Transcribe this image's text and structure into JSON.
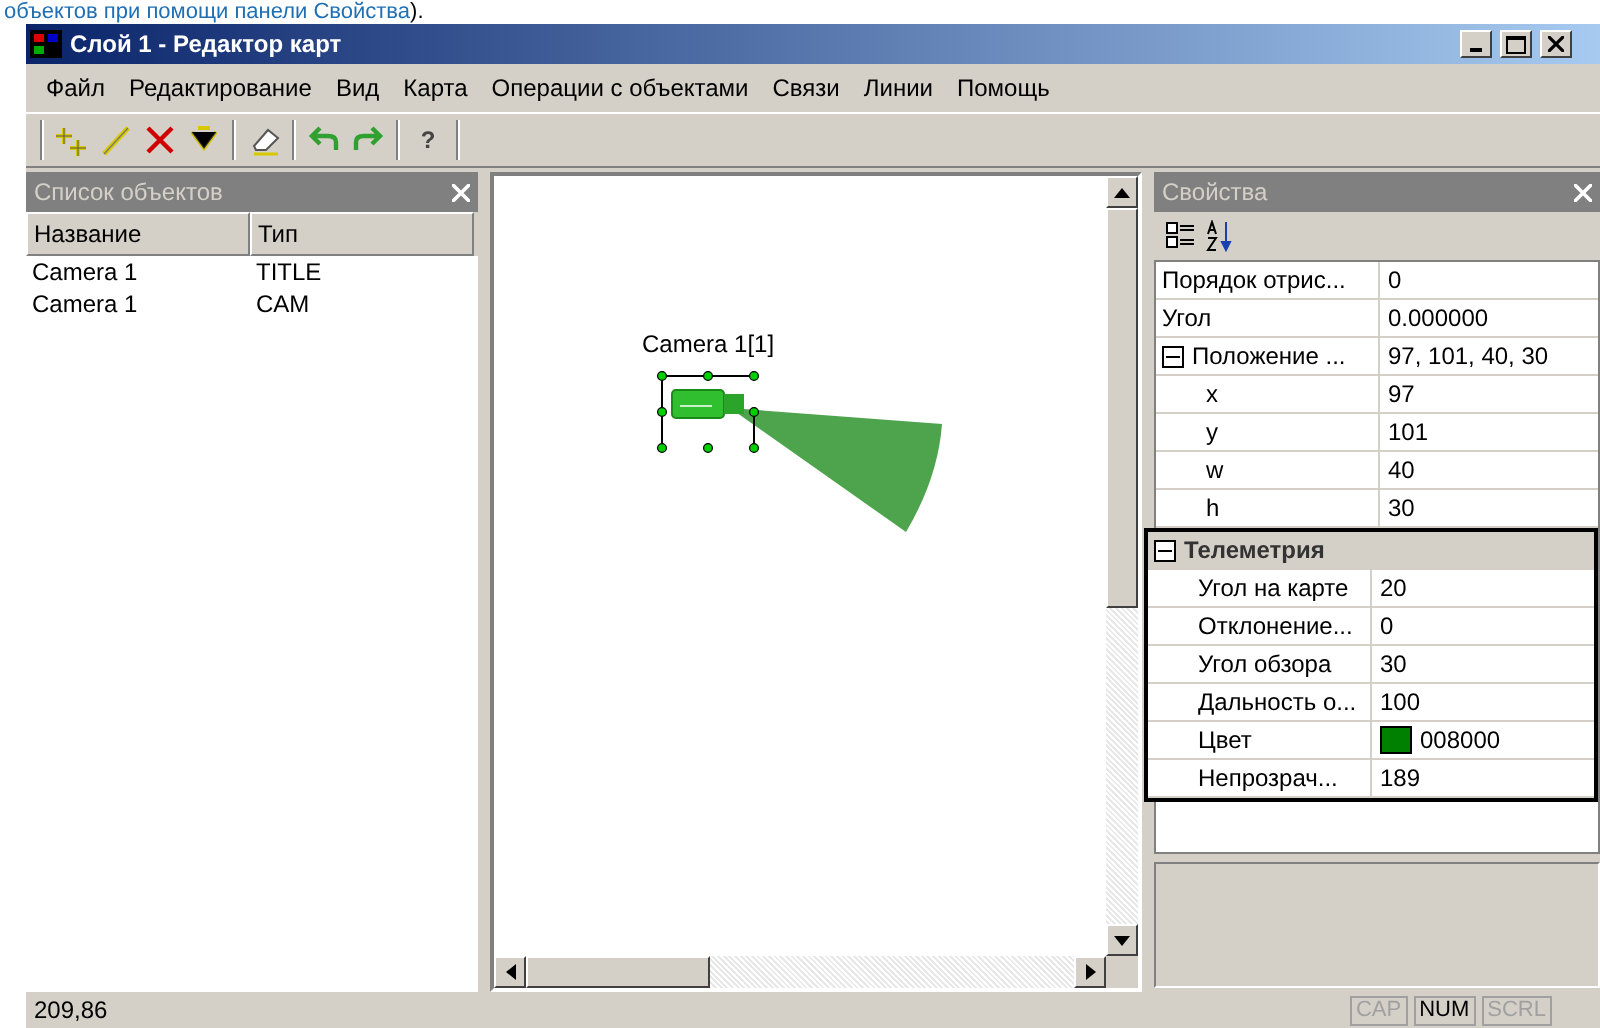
{
  "doc_text": {
    "before": "объектов при помощи панели ",
    "link": "Свойства",
    "after": ")."
  },
  "window": {
    "title": "Слой 1 - Редактор карт"
  },
  "menu": [
    "Файл",
    "Редактирование",
    "Вид",
    "Карта",
    "Операции с объектами",
    "Связи",
    "Линии",
    "Помощь"
  ],
  "toolbar": [
    {
      "kind": "add-point"
    },
    {
      "kind": "pencil"
    },
    {
      "kind": "delete"
    },
    {
      "kind": "nodes"
    },
    {
      "kind": "separator"
    },
    {
      "kind": "eraser"
    },
    {
      "kind": "separator"
    },
    {
      "kind": "undo"
    },
    {
      "kind": "redo"
    },
    {
      "kind": "separator"
    },
    {
      "kind": "help",
      "label": "?"
    }
  ],
  "objects_panel": {
    "title": "Список объектов",
    "columns": [
      "Название",
      "Тип"
    ],
    "rows": [
      [
        "Camera 1",
        "TITLE"
      ],
      [
        "Camera 1",
        "CAM"
      ]
    ]
  },
  "map": {
    "label": "Camera 1[1]",
    "selected": true
  },
  "properties_panel": {
    "title": "Свойства",
    "items": [
      {
        "kind": "prop",
        "name": "Порядок отрис...",
        "value": "0"
      },
      {
        "kind": "prop",
        "name": "Угол",
        "value": "0.000000"
      },
      {
        "kind": "prop",
        "name": "Положение ...",
        "value": "97, 101, 40, 30",
        "expanded": true,
        "children": [
          {
            "kind": "prop",
            "name": "x",
            "value": "97"
          },
          {
            "kind": "prop",
            "name": "y",
            "value": "101"
          },
          {
            "kind": "prop",
            "name": "w",
            "value": "40"
          },
          {
            "kind": "prop",
            "name": "h",
            "value": "30"
          }
        ]
      },
      {
        "kind": "category",
        "name": "Телеметрия",
        "expanded": true,
        "highlighted": true,
        "children": [
          {
            "kind": "prop",
            "name": "Угол на карте",
            "value": "20"
          },
          {
            "kind": "prop",
            "name": "Отклонение...",
            "value": "0"
          },
          {
            "kind": "prop",
            "name": "Угол обзора",
            "value": "30"
          },
          {
            "kind": "prop",
            "name": "Дальность о...",
            "value": "100"
          },
          {
            "kind": "color",
            "name": "Цвет",
            "value": "008000",
            "color": "#008000"
          },
          {
            "kind": "prop",
            "name": "Непрозрач...",
            "value": "189"
          }
        ]
      }
    ]
  },
  "status_bar": {
    "text": "209,86",
    "indicators": [
      {
        "label": "CAP",
        "on": false
      },
      {
        "label": "NUM",
        "on": true
      },
      {
        "label": "SCRL",
        "on": false
      }
    ]
  }
}
